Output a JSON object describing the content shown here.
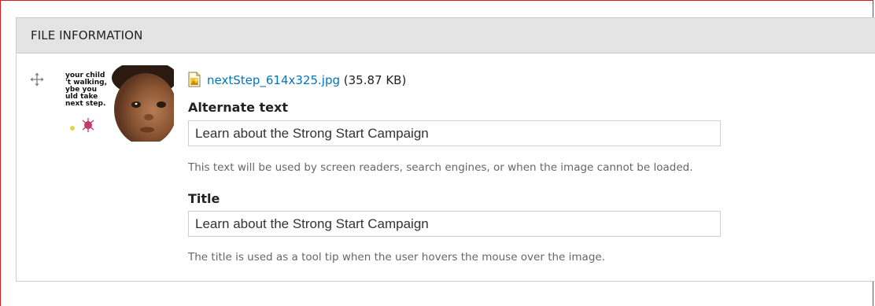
{
  "fieldset": {
    "legend": "FILE INFORMATION"
  },
  "icons": {
    "drag": "drag-handle-icon",
    "file": "image-file-icon"
  },
  "thumbnail": {
    "text_lines": [
      "your child",
      "'t walking,",
      "ybe you",
      "uld take",
      "next step."
    ]
  },
  "file": {
    "name": "nextStep_614x325.jpg",
    "size": "(35.87 KB)"
  },
  "alt": {
    "label": "Alternate text",
    "value": "Learn about the Strong Start Campaign",
    "description": "This text will be used by screen readers, search engines, or when the image cannot be loaded."
  },
  "title": {
    "label": "Title",
    "value": "Learn about the Strong Start Campaign",
    "description": "The title is used as a tool tip when the user hovers the mouse over the image."
  },
  "colors": {
    "link": "#0074bd",
    "frame_border": "#d81e1e",
    "legend_bg": "#e4e4e4"
  }
}
